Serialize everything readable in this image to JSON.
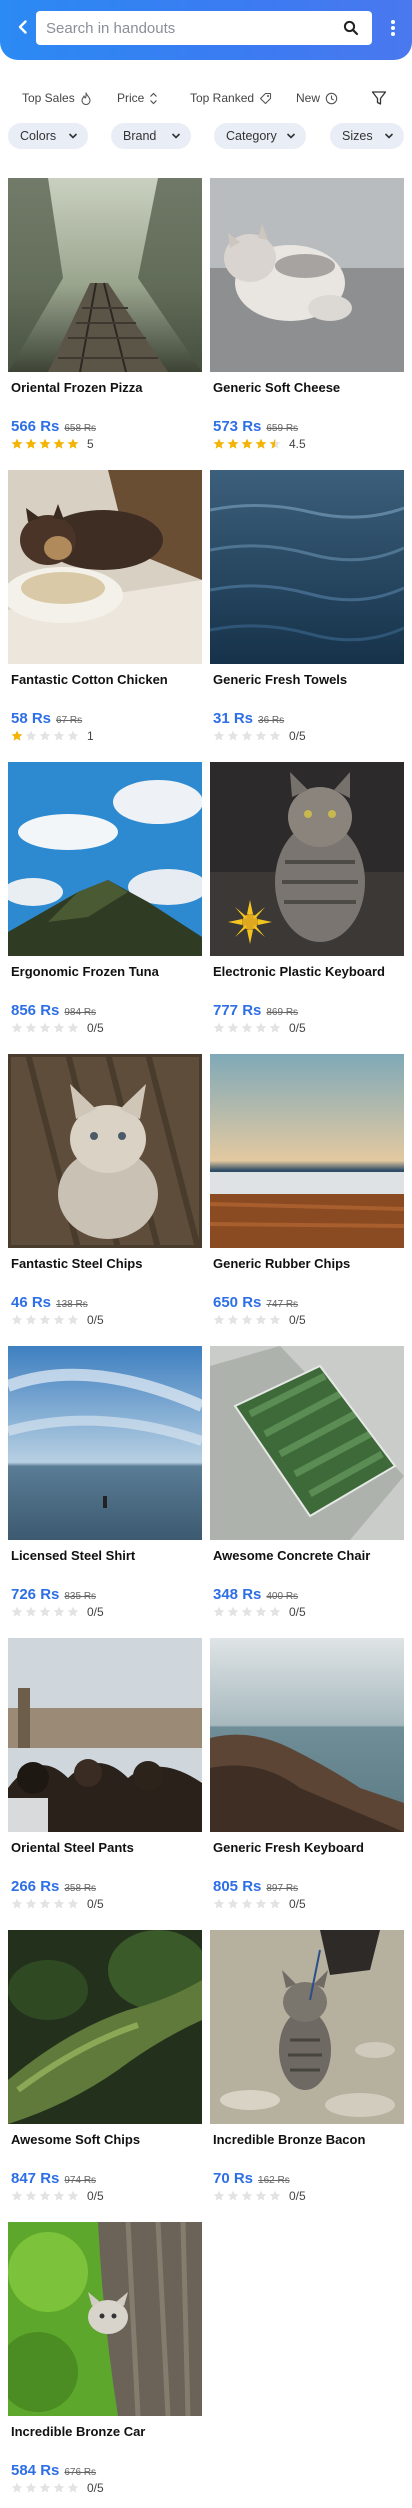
{
  "header": {
    "search_placeholder": "Search in handouts"
  },
  "sort": {
    "top_sales": "Top Sales",
    "price": "Price",
    "top_ranked": "Top Ranked",
    "new": "New"
  },
  "filters": {
    "colors": "Colors",
    "brand": "Brand",
    "category": "Category",
    "sizes": "Sizes"
  },
  "colors": {
    "accent": "#2f6fe5",
    "header": "#3b7bf2",
    "star_filled": "#f5b400",
    "star_empty": "#e3e3e3"
  },
  "products": [
    {
      "name": "Oriental Frozen Pizza",
      "price": "566 Rs",
      "old_price": "658 Rs",
      "rating": 5,
      "rating_label": "5",
      "image": "misty-railway"
    },
    {
      "name": "Generic Soft Cheese",
      "price": "573 Rs",
      "old_price": "659 Rs",
      "rating": 4.5,
      "rating_label": "4.5",
      "image": "cat-lying"
    },
    {
      "name": "Fantastic Cotton Chicken",
      "price": "58 Rs",
      "old_price": "67 Rs",
      "rating": 1,
      "rating_label": "1",
      "image": "cat-eating"
    },
    {
      "name": "Generic Fresh Towels",
      "price": "31 Rs",
      "old_price": "36 Rs",
      "rating": 0,
      "rating_label": "0/5",
      "image": "water-waves"
    },
    {
      "name": "Ergonomic Frozen Tuna",
      "price": "856 Rs",
      "old_price": "984 Rs",
      "rating": 0,
      "rating_label": "0/5",
      "image": "hill-sky"
    },
    {
      "name": "Electronic Plastic Keyboard",
      "price": "777 Rs",
      "old_price": "869 Rs",
      "rating": 0,
      "rating_label": "0/5",
      "image": "tabby-cat-flower"
    },
    {
      "name": "Fantastic Steel Chips",
      "price": "46 Rs",
      "old_price": "138 Rs",
      "rating": 0,
      "rating_label": "0/5",
      "image": "kitten-wood"
    },
    {
      "name": "Generic Rubber Chips",
      "price": "650 Rs",
      "old_price": "747 Rs",
      "rating": 0,
      "rating_label": "0/5",
      "image": "sunset-shore"
    },
    {
      "name": "Licensed Steel Shirt",
      "price": "726 Rs",
      "old_price": "835 Rs",
      "rating": 0,
      "rating_label": "0/5",
      "image": "sea-horizon"
    },
    {
      "name": "Awesome Concrete Chair",
      "price": "348 Rs",
      "old_price": "400 Rs",
      "rating": 0,
      "rating_label": "0/5",
      "image": "stadium-aerial"
    },
    {
      "name": "Oriental Steel Pants",
      "price": "266 Rs",
      "old_price": "358 Rs",
      "rating": 0,
      "rating_label": "0/5",
      "image": "crowd-pier"
    },
    {
      "name": "Generic Fresh Keyboard",
      "price": "805 Rs",
      "old_price": "897 Rs",
      "rating": 0,
      "rating_label": "0/5",
      "image": "rocky-coast"
    },
    {
      "name": "Awesome Soft Chips",
      "price": "847 Rs",
      "old_price": "974 Rs",
      "rating": 0,
      "rating_label": "0/5",
      "image": "mossy-branch"
    },
    {
      "name": "Incredible Bronze Bacon",
      "price": "70 Rs",
      "old_price": "162 Rs",
      "rating": 0,
      "rating_label": "0/5",
      "image": "cat-walking"
    },
    {
      "name": "Incredible Bronze Car",
      "price": "584 Rs",
      "old_price": "676 Rs",
      "rating": 0,
      "rating_label": "0/5",
      "image": "kitten-tree"
    }
  ]
}
